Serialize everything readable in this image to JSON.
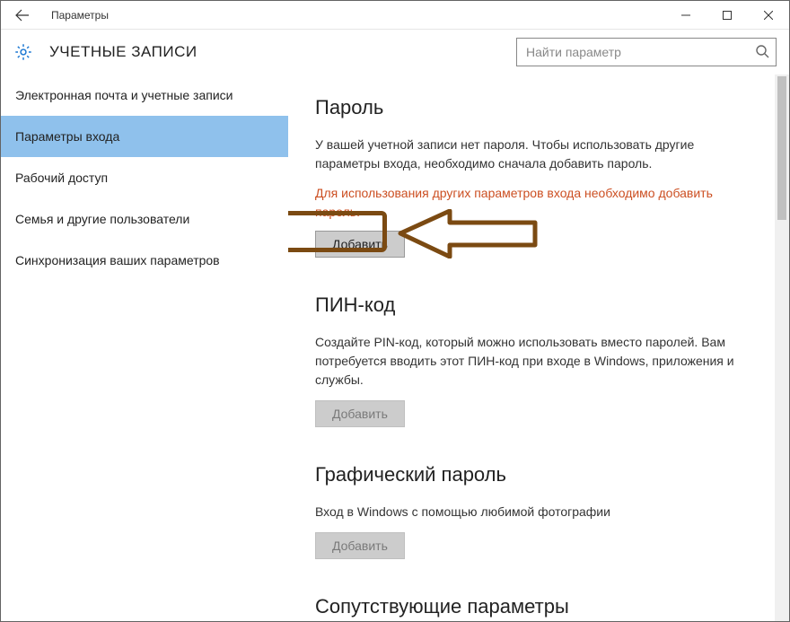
{
  "window": {
    "title": "Параметры"
  },
  "header": {
    "title": "УЧЕТНЫЕ ЗАПИСИ"
  },
  "search": {
    "placeholder": "Найти параметр"
  },
  "sidebar": {
    "items": [
      {
        "label": "Электронная почта и учетные записи",
        "selected": false
      },
      {
        "label": "Параметры входа",
        "selected": true
      },
      {
        "label": "Рабочий доступ",
        "selected": false
      },
      {
        "label": "Семья и другие пользователи",
        "selected": false
      },
      {
        "label": "Синхронизация ваших параметров",
        "selected": false
      }
    ]
  },
  "sections": {
    "password": {
      "title": "Пароль",
      "text": "У вашей учетной записи нет пароля. Чтобы использовать другие параметры входа, необходимо сначала добавить пароль.",
      "warn": "Для использования других параметров входа необходимо добавить пароль.",
      "button": "Добавить"
    },
    "pin": {
      "title": "ПИН-код",
      "text": "Создайте PIN-код, который можно использовать вместо паролей. Вам потребуется вводить этот ПИН-код при входе в Windows, приложения и службы.",
      "button": "Добавить"
    },
    "picture": {
      "title": "Графический пароль",
      "text": "Вход в Windows с помощью любимой фотографии",
      "button": "Добавить"
    },
    "related": {
      "title": "Сопутствующие параметры"
    }
  }
}
